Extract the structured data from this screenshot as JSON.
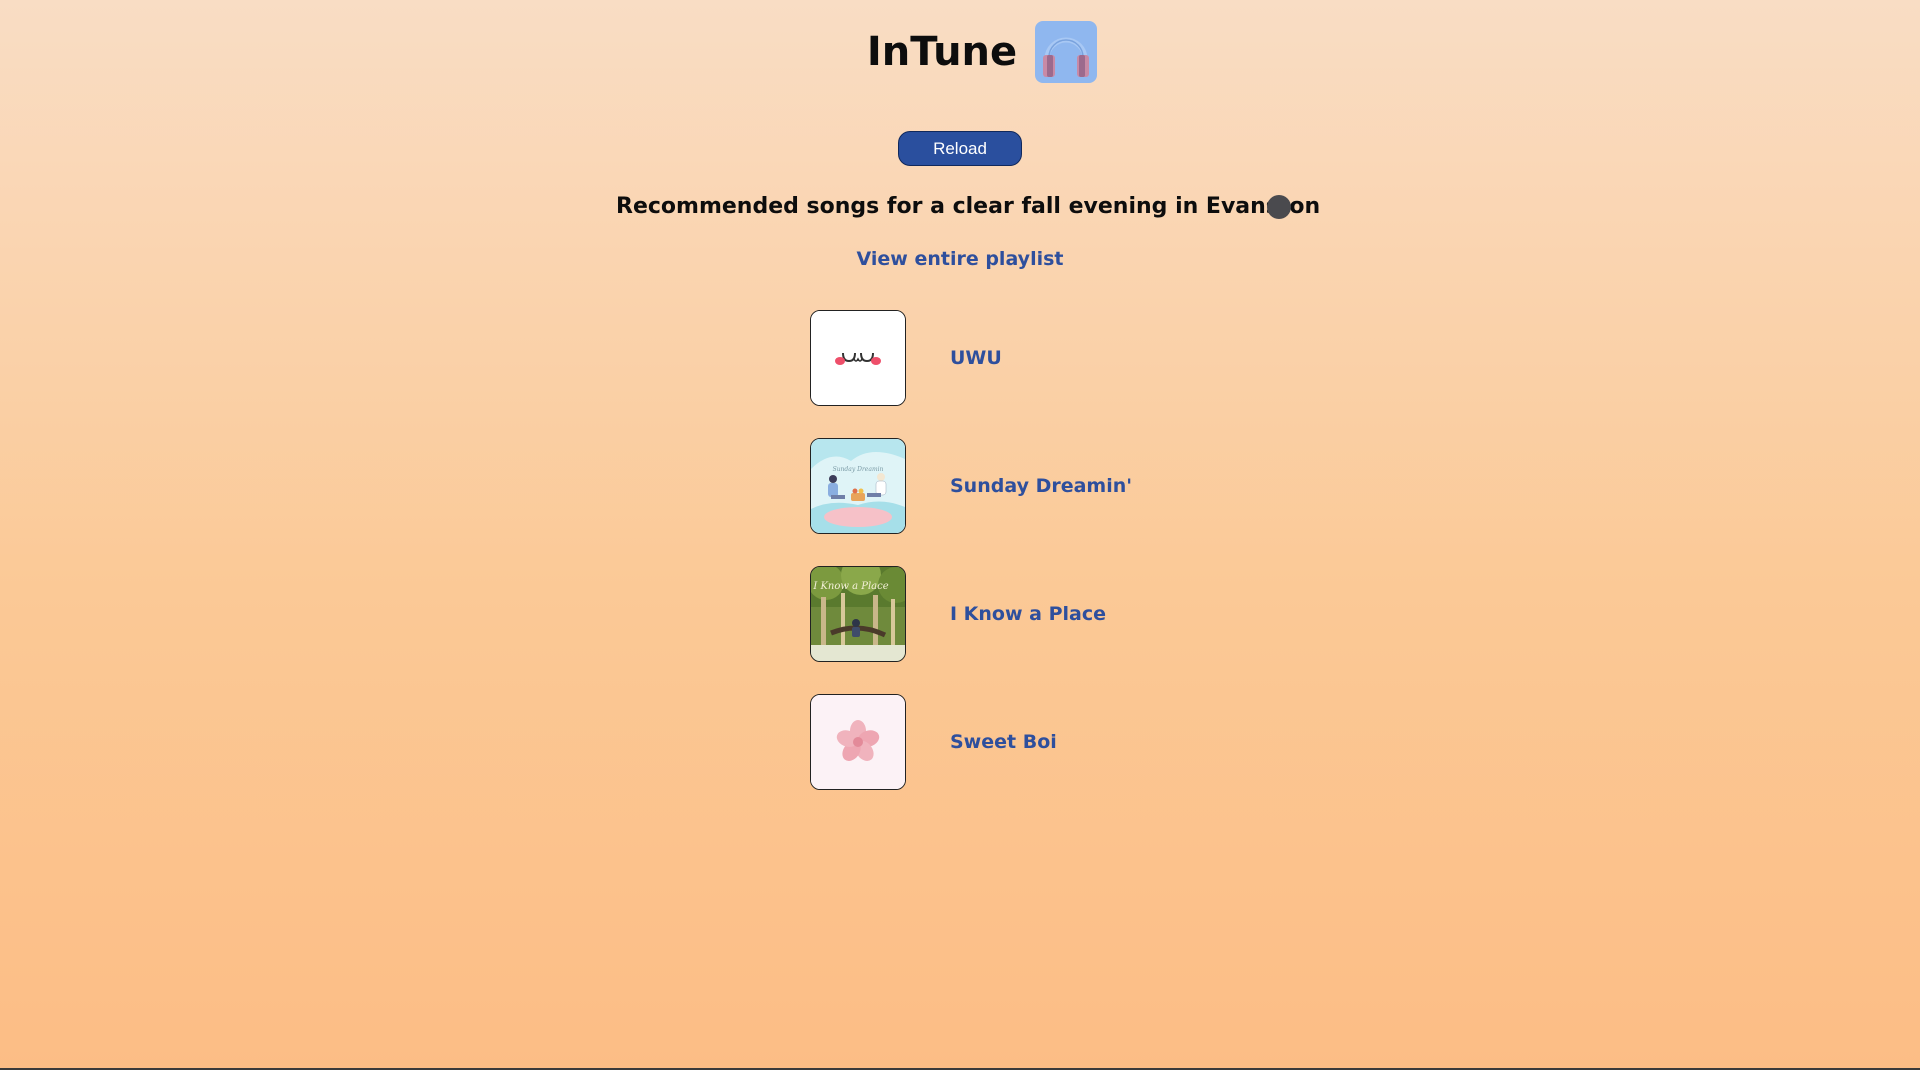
{
  "header": {
    "title": "InTune",
    "logo_icon": "headphones-icon"
  },
  "controls": {
    "reload_label": "Reload"
  },
  "recommendation": {
    "heading": "Recommended songs for a clear fall evening in Evanston",
    "status_icon": "status-dot-icon"
  },
  "playlist_link": {
    "label": "View entire playlist"
  },
  "songs": [
    {
      "title": "UWU",
      "cover": "uwu-face-cover"
    },
    {
      "title": "Sunday Dreamin'",
      "cover": "picnic-illustration-cover"
    },
    {
      "title": "I Know a Place",
      "cover": "forest-illustration-cover"
    },
    {
      "title": "Sweet Boi",
      "cover": "pink-flower-cover"
    }
  ],
  "colors": {
    "background_top": "#f9ddc4",
    "background_bottom": "#fcbd85",
    "accent_blue": "#2a4f9e",
    "link_blue": "#2e4f9d",
    "logo_blue": "#8fb7ef",
    "status_dot": "#4a4a4e"
  }
}
